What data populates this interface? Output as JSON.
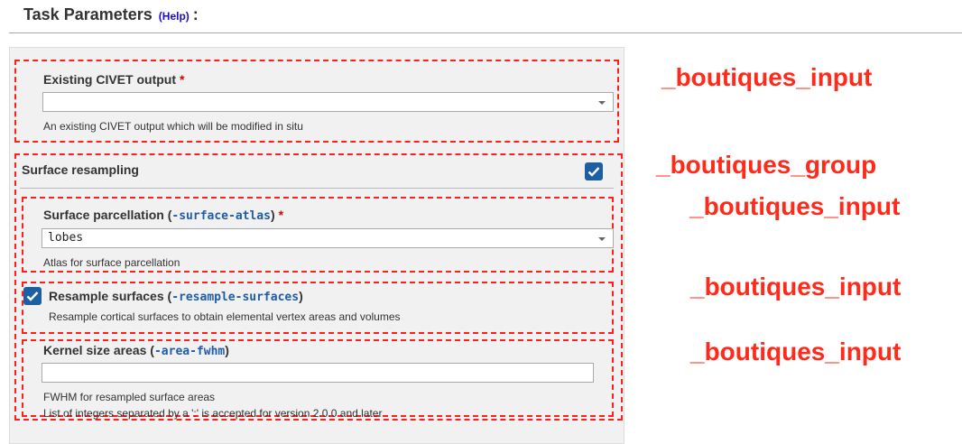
{
  "header": {
    "title": "Task Parameters",
    "help": "(Help)",
    "colon": ":"
  },
  "inputs": {
    "civet": {
      "label": "Existing CIVET output",
      "required": "*",
      "value": "",
      "description": "An existing CIVET output which will be modified in situ"
    },
    "group": {
      "title": "Surface resampling",
      "checked": true
    },
    "atlas": {
      "label": "Surface parcellation (",
      "flag": "-surface-atlas",
      "label_end": ")",
      "required": "*",
      "value": "lobes",
      "description": "Atlas for surface parcellation"
    },
    "resample": {
      "label": "Resample surfaces (",
      "flag": "-resample-surfaces",
      "label_end": ")",
      "checked": true,
      "description": "Resample cortical surfaces to obtain elemental vertex areas and volumes"
    },
    "kernel": {
      "label": "Kernel size areas (",
      "flag": "-area-fwhm",
      "label_end": ")",
      "value": "",
      "description_1": "FWHM for resampled surface areas",
      "description_2": "List of integers separated by a ':' is accepted for version 2.0.0 and later"
    }
  },
  "annotations": {
    "a1": "_boutiques_input",
    "a2": "_boutiques_group",
    "a3": "_boutiques_input",
    "a4": "_boutiques_input",
    "a5": "_boutiques_input"
  },
  "colors": {
    "annotation": "#ff2a1a",
    "checkbox": "#1d5fa3",
    "flag": "#1f5da8"
  }
}
